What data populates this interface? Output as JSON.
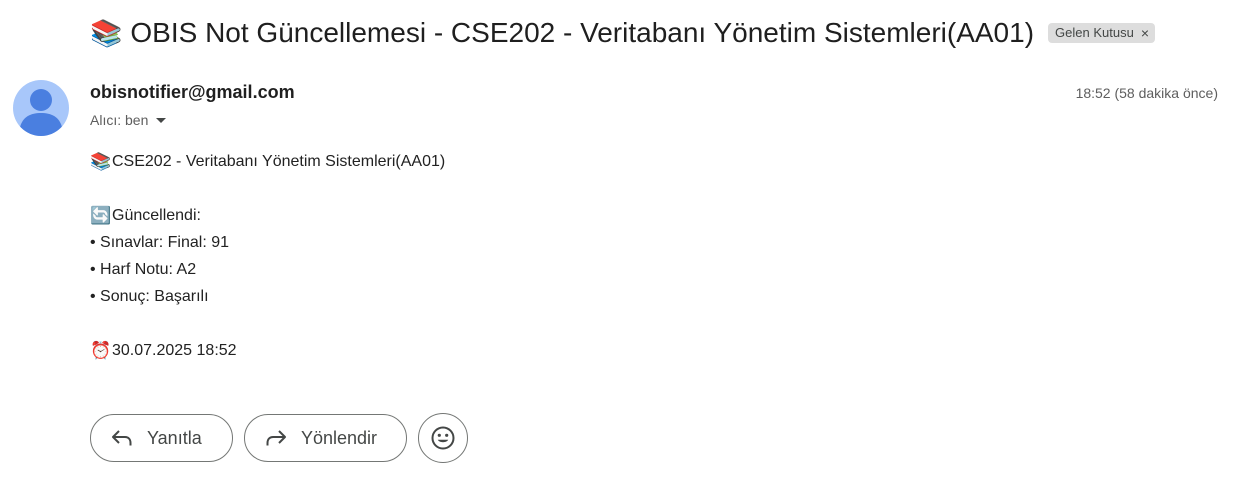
{
  "email": {
    "subject_icon": "books-emoji",
    "subject_emoji": "📚",
    "subject": "OBIS Not Güncellemesi - CSE202 - Veritabanı Yönetim Sistemleri(AA01)",
    "label": {
      "name": "Gelen Kutusu",
      "close_icon": "close-icon",
      "close_glyph": "×"
    },
    "sender": "obisnotifier@gmail.com",
    "recipient": "Alıcı: ben",
    "time": "18:52 (58 dakika önce)",
    "body": {
      "course_emoji": "📚",
      "course": "CSE202 - Veritabanı Yönetim Sistemleri(AA01)",
      "updated_emoji": "🔄",
      "updated_heading": "Güncellendi:",
      "items": [
        "• Sınavlar: Final: 91",
        "• Harf Notu: A2",
        "• Sonuç: Başarılı"
      ],
      "clock_emoji": "⏰",
      "datetime": "30.07.2025 18:52"
    }
  },
  "actions": {
    "reply_label": "Yanıtla",
    "forward_label": "Yönlendir",
    "reply_icon": "reply-icon",
    "forward_icon": "forward-icon",
    "emoji_icon": "emoji-reaction-icon"
  },
  "colors": {
    "avatar_bg": "#a8c7fa",
    "avatar_fg": "#4a7fe0",
    "chip_bg": "#dddddd",
    "text_primary": "#1f1f1f",
    "text_secondary": "#5e5e5e",
    "button_border": "#747775"
  }
}
